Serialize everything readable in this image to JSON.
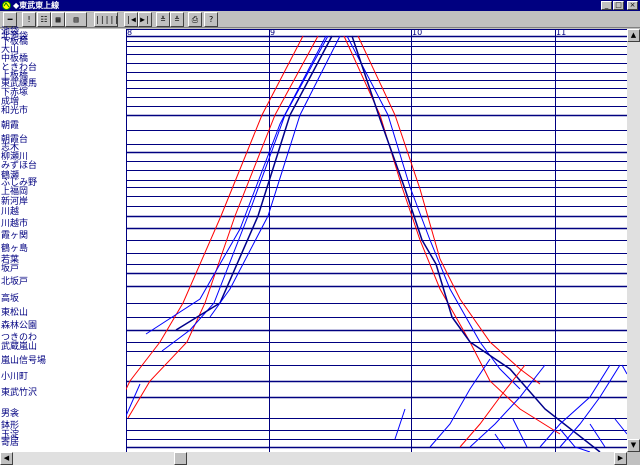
{
  "window": {
    "title": "◆東武東上線",
    "minimize_label": "_",
    "maximize_label": "□",
    "close_label": "×"
  },
  "toolbar": {
    "buttons": [
      {
        "name": "menu",
        "label": "━"
      },
      {
        "name": "info",
        "label": "!"
      },
      {
        "name": "list",
        "label": "☷"
      },
      {
        "name": "diagram",
        "label": "▦"
      },
      {
        "name": "timetable",
        "label": "▥"
      },
      {
        "name": "barcode",
        "label": "|||||"
      },
      {
        "name": "first",
        "label": "|◀"
      },
      {
        "name": "last",
        "label": "▶|"
      },
      {
        "name": "up",
        "label": "≚"
      },
      {
        "name": "down",
        "label": "≙"
      },
      {
        "name": "print",
        "label": "⎙"
      },
      {
        "name": "help",
        "label": "?"
      }
    ]
  },
  "hours": [
    "8",
    "9",
    "10",
    "11"
  ],
  "stations": [
    "池袋",
    "北池袋",
    "下板橋",
    "大山",
    "中板橋",
    "ときわ台",
    "上板橋",
    "東武練馬",
    "下赤塚",
    "成増",
    "和光市",
    "朝霞",
    "朝霞台",
    "志木",
    "柳瀬川",
    "みずほ台",
    "鶴瀬",
    "ふじみ野",
    "上福岡",
    "新河岸",
    "川越",
    "川越市",
    "霞ヶ関",
    "鶴ヶ島",
    "若葉",
    "坂戸",
    "北坂戸",
    "高坂",
    "東松山",
    "森林公園",
    "つきのわ",
    "武蔵嵐山",
    "嵐山信号場",
    "小川町",
    "東武竹沢",
    "男衾",
    "鉢形",
    "玉淀",
    "寄居"
  ],
  "colors": {
    "express": "#ff0000",
    "local": "#0000ff",
    "semi_express": "#00008b",
    "grid": "#000080",
    "title_bar": "#000080"
  },
  "scrollbars": {
    "up_label": "▲",
    "down_label": "▼",
    "left_label": "◀",
    "right_label": "▶"
  }
}
